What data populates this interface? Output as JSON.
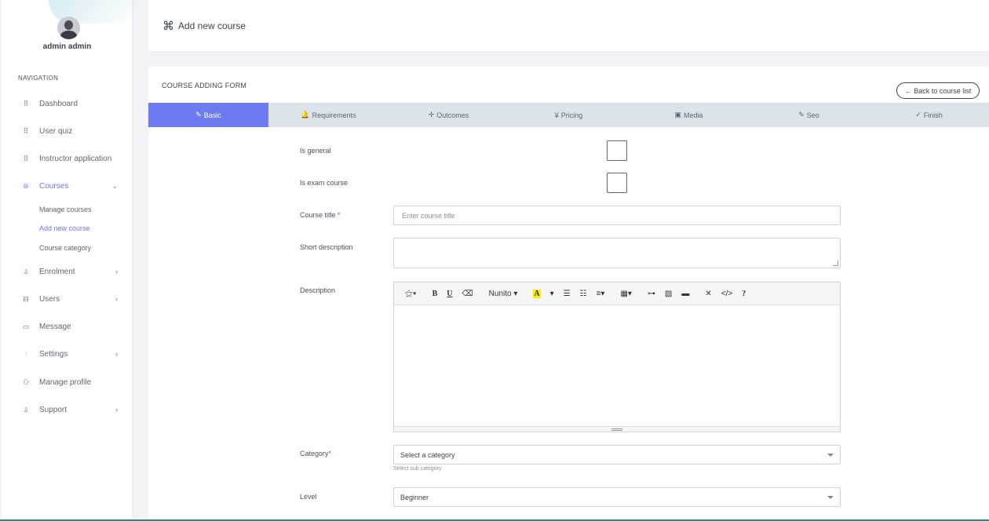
{
  "sidebar": {
    "user_name": "admin admin",
    "nav_heading": "NAVIGATION",
    "items": [
      {
        "label": "Dashboard",
        "icon": "grid-icon"
      },
      {
        "label": "User quiz",
        "icon": "grid-icon"
      },
      {
        "label": "Instructor application",
        "icon": "grid-icon"
      },
      {
        "label": "Courses",
        "icon": "basket-icon",
        "chevron": "⌄"
      },
      {
        "label": "Enrolment",
        "icon": "sitemap-icon",
        "chevron": "›"
      },
      {
        "label": "Users",
        "icon": "archive-icon",
        "chevron": "›"
      },
      {
        "label": "Message",
        "icon": "monitor-icon"
      },
      {
        "label": "Settings",
        "icon": "sliders-icon",
        "chevron": "›"
      },
      {
        "label": "Manage profile",
        "icon": "user-icon"
      },
      {
        "label": "Support",
        "icon": "sitemap-icon",
        "chevron": "›"
      }
    ],
    "courses_sub": [
      "Manage courses",
      "Add new course",
      "Course category"
    ]
  },
  "header": {
    "cmd_glyph": "⌘",
    "title": "Add new course"
  },
  "form": {
    "card_title": "COURSE ADDING FORM",
    "back_button": "← Back to course list",
    "tabs": [
      {
        "icon": "✎",
        "label": "Basic"
      },
      {
        "icon": "🔔",
        "label": "Requirements"
      },
      {
        "icon": "✛",
        "label": "Outcomes"
      },
      {
        "icon": "¥",
        "label": "Pricing"
      },
      {
        "icon": "▣",
        "label": "Media"
      },
      {
        "icon": "✎",
        "label": "Seo"
      },
      {
        "icon": "✓",
        "label": "Finish"
      }
    ],
    "is_general_label": "Is general",
    "is_exam_label": "Is exam course",
    "course_title_label": "Course title",
    "required_mark": "*",
    "course_title_placeholder": "Enter course title",
    "short_description_label": "Short description",
    "description_label": "Description",
    "editor_font": "Nunito",
    "category_label": "Category",
    "category_value": "Select a category",
    "category_help": "Select sub category",
    "level_label": "Level",
    "level_value": "Beginner"
  },
  "colors": {
    "accent": "#6d7bf0",
    "required": "#e53e3e"
  }
}
